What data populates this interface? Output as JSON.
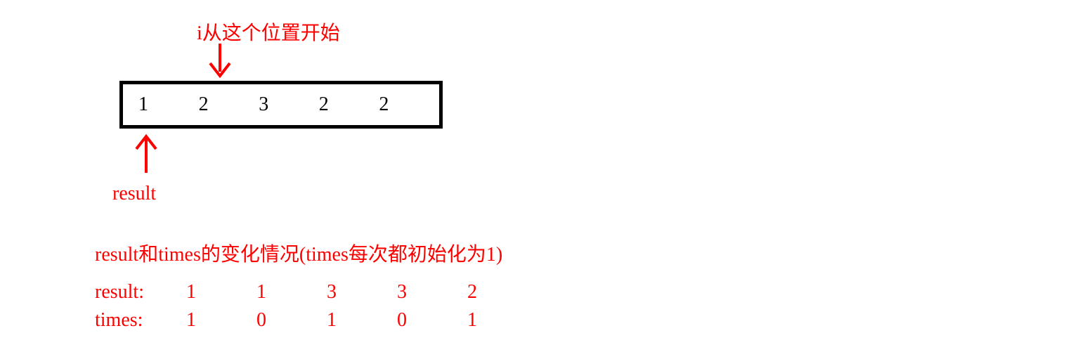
{
  "colors": {
    "accent": "#ff0000",
    "border": "#000000"
  },
  "top_label": "i从这个位置开始",
  "array": {
    "values": [
      "1",
      "2",
      "3",
      "2",
      "2"
    ]
  },
  "result_pointer_label": "result",
  "subtitle": "result和times的变化情况(times每次都初始化为1)",
  "trace": {
    "result": {
      "label": "result:",
      "values": [
        "1",
        "1",
        "3",
        "3",
        "2"
      ]
    },
    "times": {
      "label": "times:",
      "values": [
        "1",
        "0",
        "1",
        "0",
        "1"
      ]
    }
  },
  "chart_data": {
    "type": "table",
    "title": "Boyer-Moore majority vote trace",
    "input_array": [
      1,
      2,
      3,
      2,
      2
    ],
    "i_start_index": 1,
    "initial_result_index": 0,
    "times_initial": 1,
    "steps": [
      {
        "result": 1,
        "times": 1
      },
      {
        "result": 1,
        "times": 0
      },
      {
        "result": 3,
        "times": 1
      },
      {
        "result": 3,
        "times": 0
      },
      {
        "result": 2,
        "times": 1
      }
    ]
  }
}
